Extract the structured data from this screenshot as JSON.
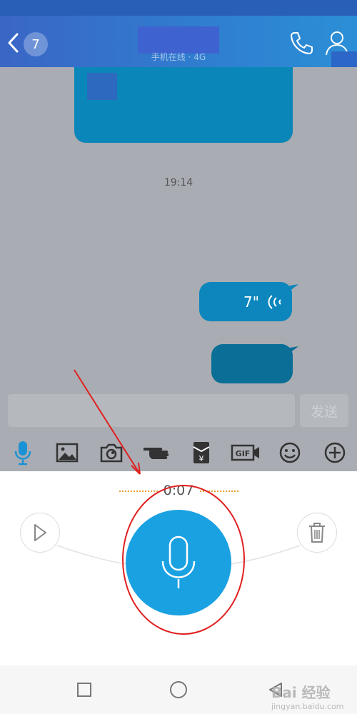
{
  "header": {
    "back_count": "7",
    "subtitle": "手机在线 · 4G"
  },
  "chat": {
    "timestamp": "19:14",
    "voice_duration": "7\""
  },
  "input": {
    "placeholder": "",
    "send_label": "发送"
  },
  "toolbar": {
    "items": [
      {
        "icon": "microphone-icon"
      },
      {
        "icon": "image-icon"
      },
      {
        "icon": "camera-icon"
      },
      {
        "icon": "poke-hand-icon"
      },
      {
        "icon": "red-packet-icon"
      },
      {
        "icon": "gif-icon"
      },
      {
        "icon": "emoji-icon"
      },
      {
        "icon": "plus-icon"
      }
    ]
  },
  "recorder": {
    "elapsed": "0:07"
  },
  "watermark": {
    "brand": "Bai 经验",
    "url": "jingyan.baidu.com"
  },
  "colors": {
    "accent": "#1aa1e2",
    "header": "#2f7fd0",
    "bubble": "#0c86bd",
    "annotation": "#e02020"
  }
}
